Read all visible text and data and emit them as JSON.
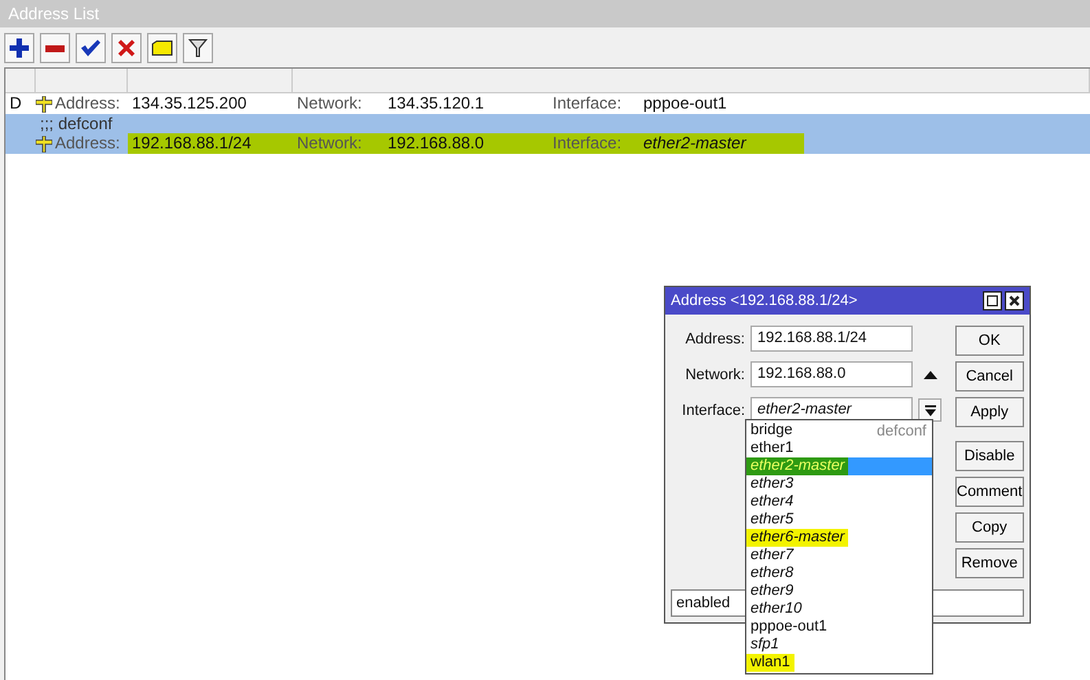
{
  "window": {
    "title": "Address List"
  },
  "toolbar": [
    {
      "kind": "add"
    },
    {
      "kind": "remove"
    },
    {
      "kind": "enable"
    },
    {
      "kind": "disable"
    },
    {
      "kind": "comment"
    },
    {
      "kind": "filter"
    }
  ],
  "rows": [
    {
      "flag": "D",
      "comment": null,
      "selected": false,
      "highlighted": false,
      "address_label": "Address:",
      "address": "134.35.125.200",
      "network_label": "Network:",
      "network": "134.35.120.1",
      "interface_label": "Interface:",
      "interface": "pppoe-out1",
      "interface_italic": false
    },
    {
      "flag": null,
      "comment": ";;; defconf",
      "selected": true,
      "highlighted": true,
      "address_label": "Address:",
      "address": "192.168.88.1/24",
      "network_label": "Network:",
      "network": "192.168.88.0",
      "interface_label": "Interface:",
      "interface": "ether2-master",
      "interface_italic": true
    }
  ],
  "dialog": {
    "title": "Address <192.168.88.1/24>",
    "fields": [
      {
        "kind": "text",
        "label": "Address:",
        "value": "192.168.88.1/24",
        "italic": false
      },
      {
        "kind": "arrow",
        "label": "Network:",
        "value": "192.168.88.0",
        "italic": false
      },
      {
        "kind": "select",
        "label": "Interface:",
        "value": "ether2-master",
        "italic": true
      }
    ],
    "buttons": [
      "OK",
      "Cancel",
      "Apply",
      "Disable",
      "Comment",
      "Copy",
      "Remove"
    ],
    "status": "enabled"
  },
  "dropdown": [
    {
      "name": "bridge",
      "comment": "defconf",
      "italic": false,
      "selected": false,
      "highlighted": false
    },
    {
      "name": "ether1",
      "italic": false,
      "selected": false,
      "highlighted": false
    },
    {
      "name": "ether2-master",
      "italic": true,
      "selected": true,
      "highlighted": true
    },
    {
      "name": "ether3",
      "italic": true,
      "selected": false,
      "highlighted": false
    },
    {
      "name": "ether4",
      "italic": true,
      "selected": false,
      "highlighted": false
    },
    {
      "name": "ether5",
      "italic": true,
      "selected": false,
      "highlighted": false
    },
    {
      "name": "ether6-master",
      "italic": true,
      "selected": false,
      "highlighted": true
    },
    {
      "name": "ether7",
      "italic": true,
      "selected": false,
      "highlighted": false
    },
    {
      "name": "ether8",
      "italic": true,
      "selected": false,
      "highlighted": false
    },
    {
      "name": "ether9",
      "italic": true,
      "selected": false,
      "highlighted": false
    },
    {
      "name": "ether10",
      "italic": true,
      "selected": false,
      "highlighted": false
    },
    {
      "name": "pppoe-out1",
      "italic": false,
      "selected": false,
      "highlighted": false
    },
    {
      "name": "sfp1",
      "italic": true,
      "selected": false,
      "highlighted": false
    },
    {
      "name": "wlan1",
      "italic": false,
      "selected": false,
      "highlighted": true
    }
  ]
}
